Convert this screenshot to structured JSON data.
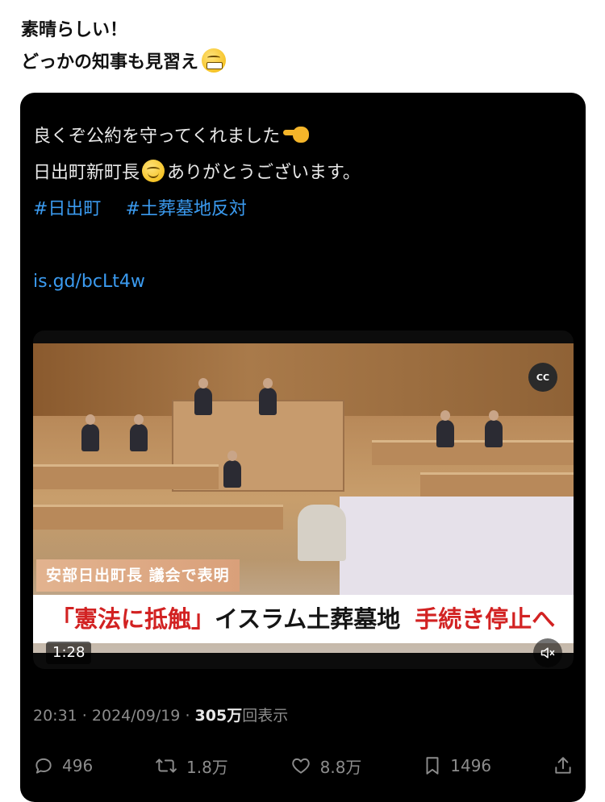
{
  "comment": {
    "line1": "素晴らしい！",
    "line2": "どっかの知事も見習え"
  },
  "post": {
    "line1": "良くぞ公約を守ってくれました",
    "line2a": "日出町新町長",
    "line2b": "ありがとうございます。",
    "hashtags": [
      "#日出町",
      "#土葬墓地反対"
    ],
    "link": "is.gd/bcLt4w"
  },
  "video": {
    "cc_label": "CC",
    "caption_small": "安部日出町長 議会で表明",
    "caption_big_red": "「憲法に抵触」",
    "caption_big_black": "イスラム土葬墓地",
    "caption_big_red2": "手続き停止へ",
    "duration": "1:28"
  },
  "meta": {
    "time": "20:31",
    "sep1": " · ",
    "date": "2024/09/19",
    "sep2": " · ",
    "views": "305万",
    "views_label": "回表示"
  },
  "actions": {
    "replies": "496",
    "reposts": "1.8万",
    "likes": "8.8万",
    "bookmarks": "1496"
  },
  "icons": {
    "reply": "speech-bubble-icon",
    "repost": "repost-arrows-icon",
    "like": "heart-icon",
    "bookmark": "bookmark-icon",
    "share": "share-upload-icon",
    "mute": "muted-speaker-icon"
  },
  "colors": {
    "card_bg": "#000000",
    "hashtag": "#3b9bf0",
    "meta_gray": "#8c8c8c",
    "caption_red": "#d22222"
  }
}
